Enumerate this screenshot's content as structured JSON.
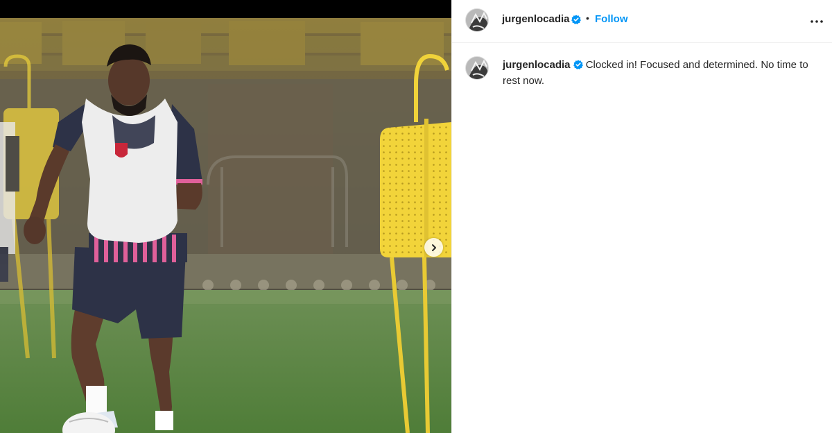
{
  "post": {
    "image_alt": "Player in pink-striped kit and white training bib running with a ball next to yellow free-kick mannequins on a stadium pitch"
  },
  "header": {
    "username": "jurgenlocadia",
    "separator": "•",
    "follow_label": "Follow"
  },
  "caption": {
    "username": "jurgenlocadia",
    "text": "Clocked in! Focused and determined. No time to rest now."
  },
  "colors": {
    "follow": "#0095f6",
    "verified": "#0095f6",
    "pitch": "#5e8a45",
    "mannequin": "#f2d43a",
    "bib": "#eeeeee",
    "kit_stripe": "#e0609a"
  },
  "icons": {
    "next": "chevron-right-icon",
    "more": "more-horizontal-icon",
    "verified": "verified-badge-icon"
  }
}
